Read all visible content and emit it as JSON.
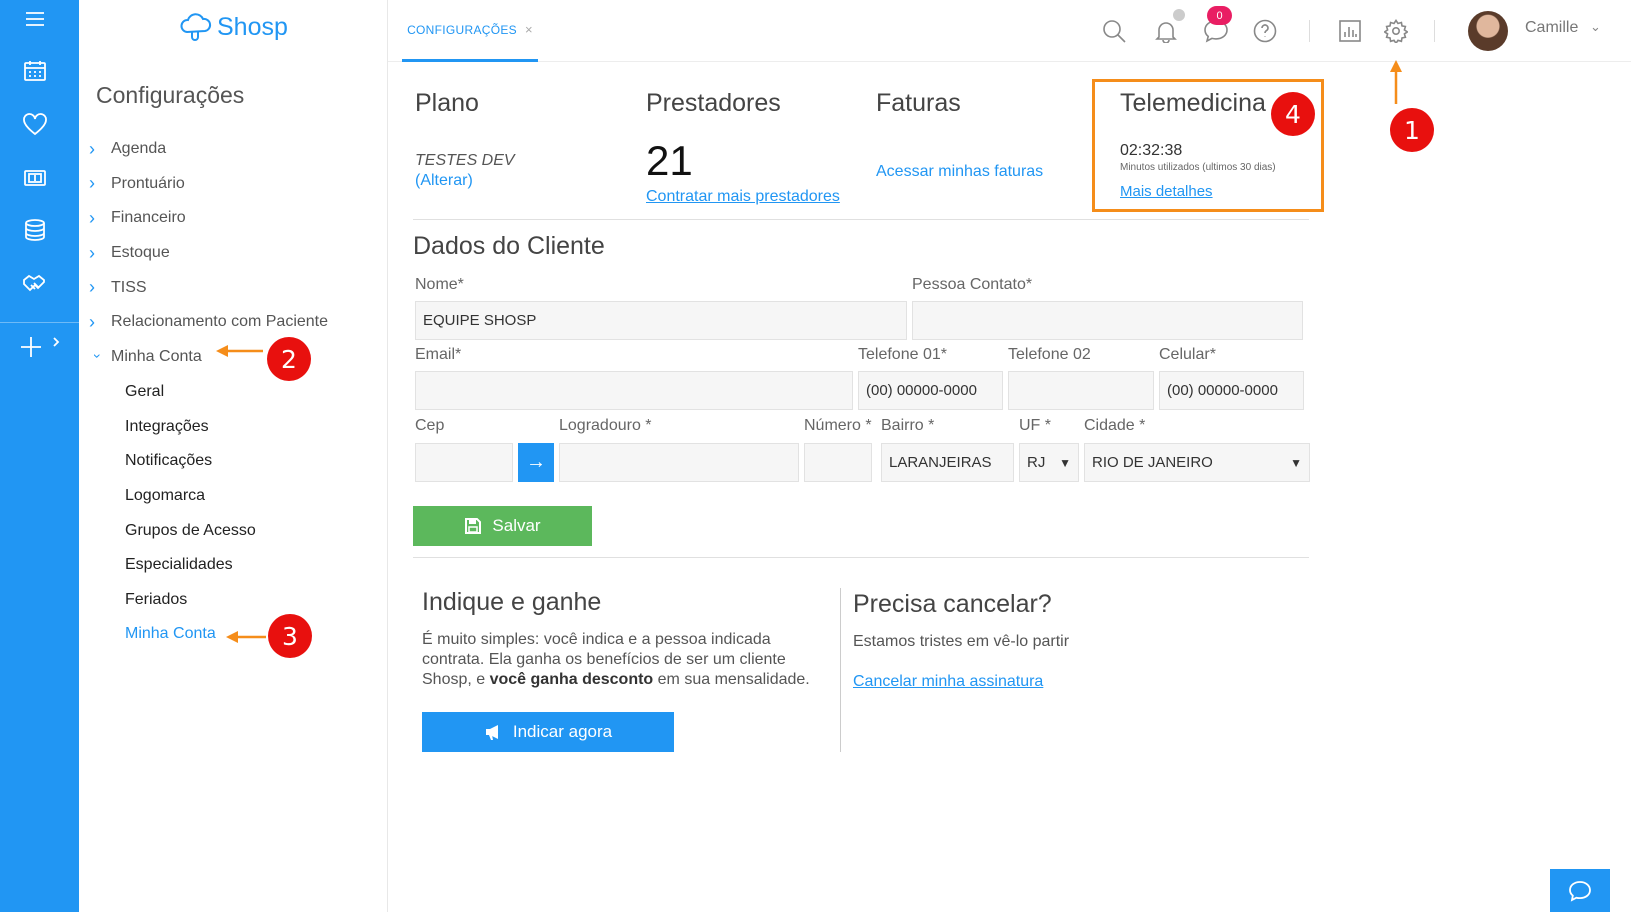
{
  "app": {
    "logo_text": "Shosp"
  },
  "sidebar": {
    "title": "Configurações",
    "items": [
      {
        "label": "Agenda"
      },
      {
        "label": "Prontuário"
      },
      {
        "label": "Financeiro"
      },
      {
        "label": "Estoque"
      },
      {
        "label": "TISS"
      },
      {
        "label": "Relacionamento com Paciente"
      },
      {
        "label": "Minha Conta"
      }
    ],
    "submenu": [
      {
        "label": "Geral"
      },
      {
        "label": "Integrações"
      },
      {
        "label": "Notificações"
      },
      {
        "label": "Logomarca"
      },
      {
        "label": "Grupos de Acesso"
      },
      {
        "label": "Especialidades"
      },
      {
        "label": "Feriados"
      },
      {
        "label": "Minha Conta"
      }
    ],
    "active_item": "Minha Conta"
  },
  "topbar": {
    "tab_label": "CONFIGURAÇÕES",
    "tab_close": "×",
    "messages_badge": "0",
    "user_name": "Camille",
    "icons": [
      "search-icon",
      "bell-icon",
      "chat-icon",
      "help-icon",
      "report-icon",
      "gear-icon",
      "chevron-down-icon"
    ]
  },
  "summary": {
    "plano": {
      "title": "Plano",
      "name": "TESTES DEV",
      "change": "(Alterar)"
    },
    "prestadores": {
      "title": "Prestadores",
      "count": "21",
      "link": "Contratar mais prestadores"
    },
    "faturas": {
      "title": "Faturas",
      "link": "Acessar minhas faturas"
    },
    "telemedicina": {
      "title": "Telemedicina",
      "time": "02:32:38",
      "caption": "Minutos utilizados (ultimos 30 dias)",
      "link": "Mais detalhes"
    }
  },
  "client": {
    "section_title": "Dados do Cliente",
    "labels": {
      "nome": "Nome*",
      "pessoa": "Pessoa Contato*",
      "email": "Email*",
      "tel1": "Telefone 01*",
      "tel2": "Telefone 02",
      "cel": "Celular*",
      "cep": "Cep",
      "logradouro": "Logradouro *",
      "numero": "Número *",
      "bairro": "Bairro *",
      "uf": "UF *",
      "cidade": "Cidade *"
    },
    "values": {
      "nome": "EQUIPE SHOSP",
      "pessoa": "",
      "email": "",
      "tel1": "(00) 00000-0000",
      "tel2": "",
      "cel": "(00) 00000-0000",
      "cep": "",
      "logradouro": "",
      "numero": "",
      "bairro": "LARANJEIRAS",
      "uf": "RJ",
      "cidade": "RIO DE JANEIRO"
    },
    "save_label": "Salvar"
  },
  "referral": {
    "title": "Indique e ganhe",
    "line1": "É muito simples: você indica e a pessoa indicada",
    "line2": "contrata. Ela ganha os benefícios de ser um cliente",
    "line3_a": "Shosp, e ",
    "line3_b": "você ganha desconto",
    "line3_c": " em sua mensalidade.",
    "button": "Indicar agora"
  },
  "cancel": {
    "title": "Precisa cancelar?",
    "text": "Estamos tristes em vê-lo partir",
    "link": "Cancelar minha assinatura"
  },
  "annotations": {
    "m1": "1",
    "m2": "2",
    "m3": "3",
    "m4": "4",
    "color": "#e8100e",
    "arrow_color": "#f58d1a"
  },
  "colors": {
    "primary": "#2196f3",
    "save": "#5cb85c",
    "badge": "#e91e63"
  }
}
